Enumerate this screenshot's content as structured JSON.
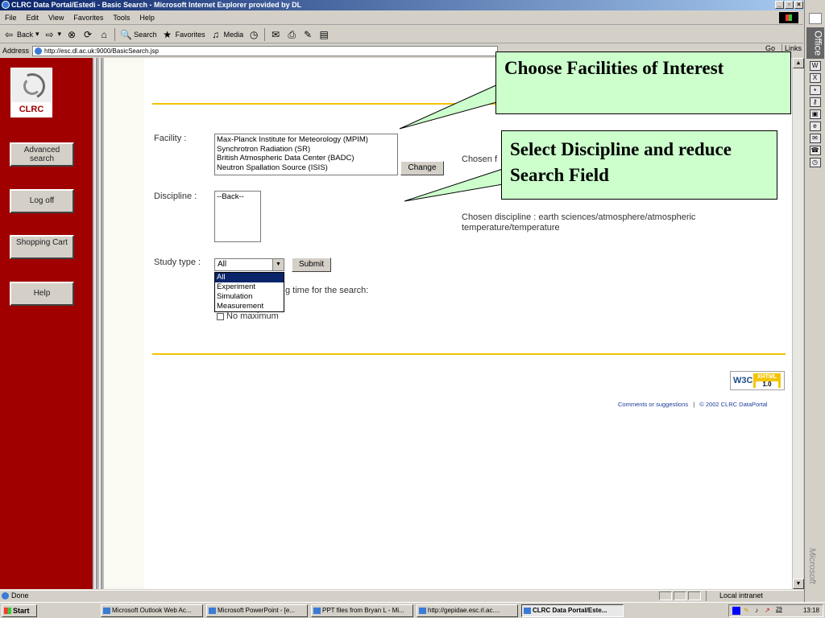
{
  "window": {
    "title": "CLRC Data Portal/Estedi - Basic Search - Microsoft Internet Explorer provided by DL"
  },
  "menu": [
    "File",
    "Edit",
    "View",
    "Favorites",
    "Tools",
    "Help"
  ],
  "toolbar": {
    "back": "Back",
    "search": "Search",
    "favorites": "Favorites",
    "media": "Media"
  },
  "address": {
    "label": "Address",
    "url": "http://esc.dl.ac.uk:9000/BasicSearch.jsp",
    "go": "Go",
    "links": "Links"
  },
  "office": {
    "title": "Office",
    "brand": "Microsoft"
  },
  "sidebar": {
    "logo_text": "CLRC",
    "buttons": [
      "Advanced search",
      "Log off",
      "Shopping Cart",
      "Help"
    ]
  },
  "page": {
    "heading_fragment": "ch",
    "facility": {
      "label": "Facility :",
      "options": [
        "Max-Planck Institute for Meteorology (MPIM)",
        "Synchrotron Radiation (SR)",
        "British Atmospheric Data Center (BADC)",
        "Neutron Spallation Source (ISIS)"
      ],
      "change_button": "Change",
      "chosen_fragment": "Chosen f"
    },
    "discipline": {
      "label": "Discipline :",
      "options": [
        "--Back--"
      ],
      "chosen": "Chosen discipline : earth sciences/atmosphere/atmospheric temperature/temperature"
    },
    "study_type": {
      "label": "Study type :",
      "selected": "All",
      "submit": "Submit",
      "options": [
        "All",
        "Experiment",
        "Simulation",
        "Measurement"
      ]
    },
    "time_text": "g time for the search:",
    "no_maximum": "No maximum",
    "footer": {
      "comments": "Comments or suggestions",
      "separator": "|",
      "copyright": "© 2002 CLRC DataPortal"
    },
    "w3c": {
      "w3c": "W3C",
      "xhtml": "XHTML",
      "version": "1.0"
    }
  },
  "callouts": {
    "facilities": "Choose Facilities of Interest",
    "discipline": "Select Discipline and reduce Search Field"
  },
  "status": {
    "text": "Done",
    "zone": "Local intranet"
  },
  "taskbar": {
    "start": "Start",
    "tasks": [
      "Microsoft Outlook Web Ac...",
      "Microsoft PowerPoint - [e...",
      "PPT files from Bryan L - Mi...",
      "http://gepidae.esc.rl.ac....",
      "CLRC Data Portal/Este..."
    ],
    "tray_date": "29",
    "clock": "13:18"
  }
}
